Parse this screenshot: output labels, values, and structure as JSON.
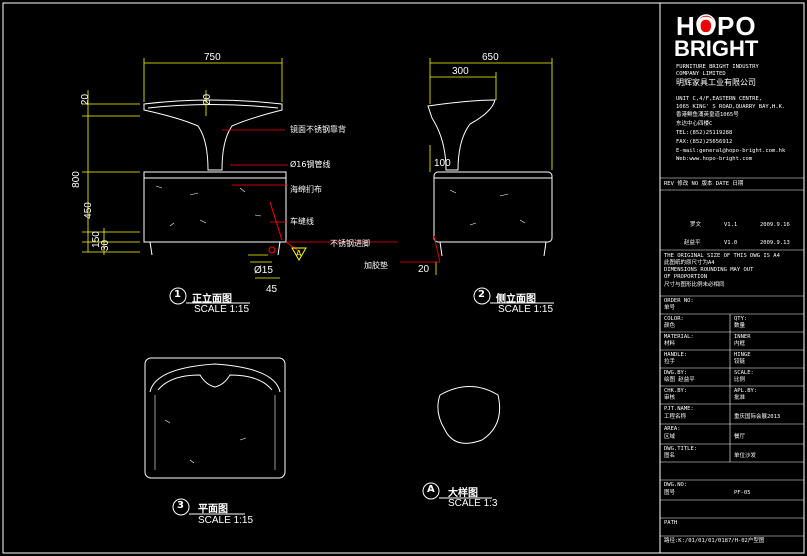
{
  "logo": {
    "line1": "HOPO",
    "line2": "BRIGHT"
  },
  "company": {
    "name_en_1": "FURNITURE BRIGHT INDUSTRY",
    "name_en_2": "COMPANY LIMITED",
    "name_cn": "明辉家具工业有限公司",
    "addr_1": "UNIT C,4/F,EASTERN CENTRE,",
    "addr_2": "1065 KING' S ROAD,QUARRY BAY,H.K.",
    "addr_3": "香港鲗鱼涌英皇道1065号",
    "addr_4": "东达中心四楼C",
    "tel": "TEL:(852)25119288",
    "fax": "FAX:(852)25656912",
    "email": "E-mail:general@hopo-bright.com.hk",
    "web": "Web:www.hopo-bright.com"
  },
  "revision": {
    "header": "REV 修改   NO 版本   DATE 日期",
    "row1_name": "罗文",
    "row1_ver": "V1.1",
    "row1_date": "2009.9.16",
    "row2_name": "赵益平",
    "row2_ver": "V1.0",
    "row2_date": "2009.9.13"
  },
  "notes": {
    "n1": "THE ORIGINAL SIZE OF THIS DWG IS A4",
    "n2": "此图纸的原尺寸为A4",
    "n3": "DIMENSIONS ROUNDING MAY OUT",
    "n4": "OF PROPORTION",
    "n5": "尺寸与图形比例未必相同"
  },
  "fields": {
    "order_label": "ORDER NO:",
    "order_cn": "单号",
    "color_label": "COLOR:",
    "color_cn": "颜色",
    "color_val": "QTY:",
    "color_val_cn": "数量",
    "material_label": "MATERIAL:",
    "material_cn": "材料",
    "material_val": "INNER",
    "material_val_cn": "内框",
    "handle_label": "HANDLE:",
    "handle_cn": "拉手",
    "handle_val": "HINGE",
    "handle_val_cn": "铰链",
    "dwg_label": "DWG.BY:",
    "dwg_cn": "绘图  赵益平",
    "scale_label": "SCALE:",
    "scale_cn": "比例",
    "chk_label": "CHK.BY:",
    "chk_cn": "审核",
    "appl_label": "APL.BY:",
    "appl_cn": "批准",
    "prj_label": "PJT.NAME:",
    "prj_cn": "工程名称",
    "prj_val": "重庆国际会展2013",
    "area_label": "AREA:",
    "area_cn": "区域",
    "area_val": "餐厅",
    "title_label": "DWG.TITLE:",
    "title_cn": "图名",
    "title_val": "单位沙发",
    "no_label": "DWG.NO:",
    "no_cn": "图号",
    "no_val": "PF-05",
    "path_label": "PATH",
    "path_val": "路径:K:/01/01/01/0187/H-02户型图"
  },
  "views": {
    "front_no": "1",
    "front_title": "正立面图",
    "front_scale": "SCALE 1:15",
    "side_no": "2",
    "side_title": "侧立面图",
    "side_scale": "SCALE 1:15",
    "plan_no": "3",
    "plan_title": "平面图",
    "plan_scale": "SCALE 1:15",
    "detail_no": "A",
    "detail_title": "大样图",
    "detail_scale": "SCALE 1:3"
  },
  "dims": {
    "w750": "750",
    "d650": "650",
    "d300": "300",
    "h20": "20",
    "h20b": "20",
    "h800": "800",
    "h450": "450",
    "h150": "150",
    "h30": "30",
    "h100": "100",
    "d15": "Ø15",
    "d45": "45",
    "h20c": "20"
  },
  "labels": {
    "l1": "镜面不锈钢靠背",
    "l2": "Ø16钢管线",
    "l3": "海绵扪布",
    "l4": "车缝线",
    "l5": "不锈钢进脚",
    "l6": "加胶垫",
    "callout": "A"
  }
}
